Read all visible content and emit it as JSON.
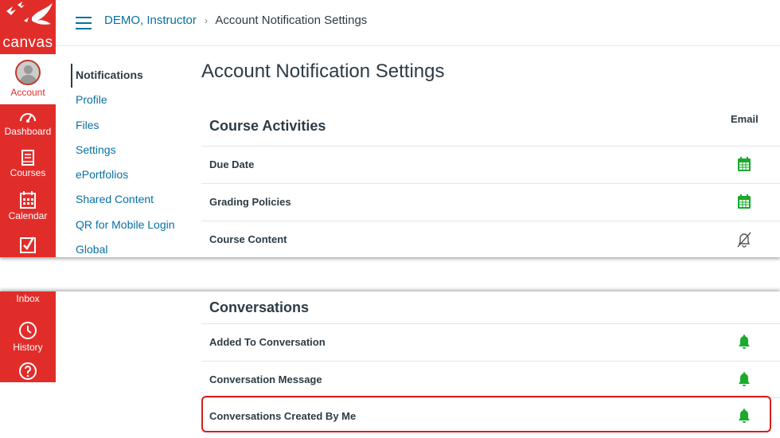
{
  "brand": {
    "name": "canvas",
    "color": "#e12d2a",
    "accent": "#0770a3",
    "status_green": "#1aaa2c"
  },
  "global_nav": {
    "account": "Account",
    "dashboard": "Dashboard",
    "courses": "Courses",
    "calendar": "Calendar",
    "inbox": "Inbox",
    "history": "History"
  },
  "breadcrumb": {
    "user": "DEMO, Instructor",
    "current": "Account Notification Settings"
  },
  "account_nav": [
    "Notifications",
    "Profile",
    "Files",
    "Settings",
    "ePortfolios",
    "Shared Content",
    "QR for Mobile Login",
    "Global"
  ],
  "page": {
    "title": "Account Notification Settings",
    "email_header": "Email"
  },
  "course_activities": {
    "title": "Course Activities",
    "rows": [
      {
        "label": "Due Date",
        "icon": "calendar-daily-icon"
      },
      {
        "label": "Grading Policies",
        "icon": "calendar-daily-icon"
      },
      {
        "label": "Course Content",
        "icon": "bell-off-icon"
      }
    ]
  },
  "conversations": {
    "title": "Conversations",
    "rows": [
      {
        "label": "Added To Conversation",
        "icon": "bell-icon"
      },
      {
        "label": "Conversation Message",
        "icon": "bell-icon"
      },
      {
        "label": "Conversations Created By Me",
        "icon": "bell-icon"
      }
    ]
  }
}
